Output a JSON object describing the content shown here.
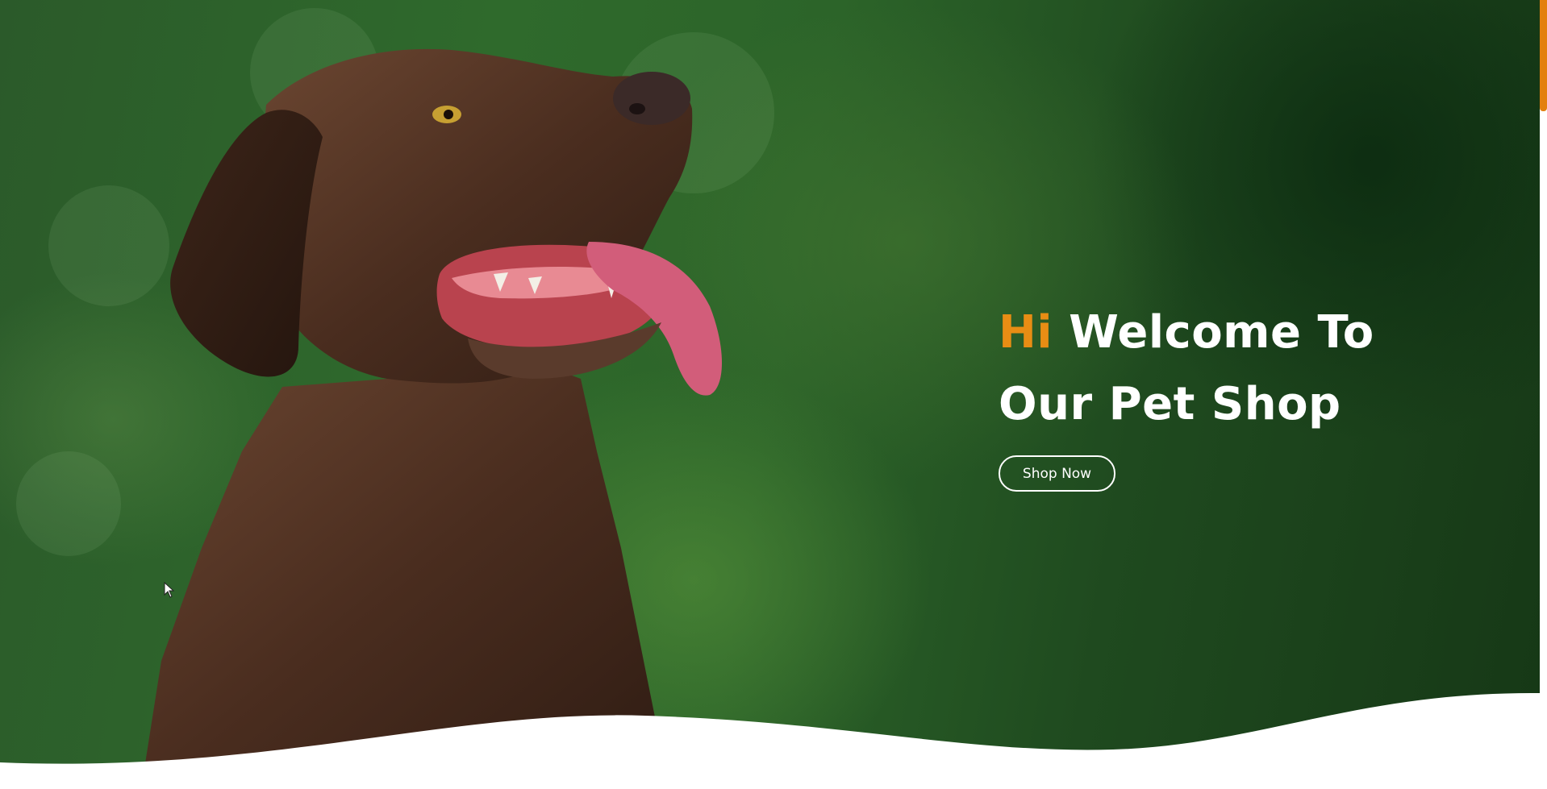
{
  "hero": {
    "headline_accent": "Hi",
    "headline_line1_rest": "Welcome To",
    "headline_line2": "Our Pet Shop",
    "cta_label": "Shop Now"
  },
  "colors": {
    "accent": "#e88d14",
    "scrollbar_thumb": "#e3800f",
    "text": "#ffffff",
    "background_green": "#2c6429"
  },
  "icons": {
    "cursor": "mouse-pointer-icon"
  }
}
